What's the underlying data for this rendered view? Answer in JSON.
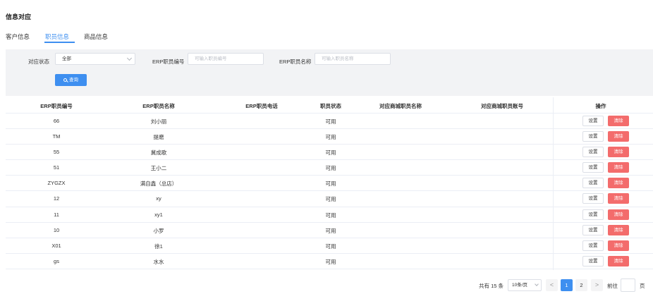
{
  "page": {
    "title": "信息对应"
  },
  "tabs": [
    {
      "label": "客户信息",
      "active": false
    },
    {
      "label": "职员信息",
      "active": true
    },
    {
      "label": "商品信息",
      "active": false
    }
  ],
  "filters": {
    "status_label": "对应状态",
    "status_value": "全部",
    "code_label": "ERP职员编号",
    "code_placeholder": "可输入职员编号",
    "name_label": "ERP职员名称",
    "name_placeholder": "可输入职员名称",
    "query_label": "查询"
  },
  "table": {
    "headers": [
      "ERP职员编号",
      "ERP职员名称",
      "ERP职员电话",
      "职员状态",
      "对应商城职员名称",
      "对应商城职员账号",
      "操作"
    ],
    "rows": [
      {
        "code": "66",
        "name": "刘小丽",
        "phone": "",
        "status": "可用",
        "mall_name": "",
        "mall_account": ""
      },
      {
        "code": "TM",
        "name": "提磨",
        "phone": "",
        "status": "可用",
        "mall_name": "",
        "mall_account": ""
      },
      {
        "code": "55",
        "name": "冀成歌",
        "phone": "",
        "status": "可用",
        "mall_name": "",
        "mall_account": ""
      },
      {
        "code": "51",
        "name": "王小二",
        "phone": "",
        "status": "可用",
        "mall_name": "",
        "mall_account": ""
      },
      {
        "code": "ZYGZX",
        "name": "满自鑫（总店）",
        "phone": "",
        "status": "可用",
        "mall_name": "",
        "mall_account": ""
      },
      {
        "code": "12",
        "name": "xy",
        "phone": "",
        "status": "可用",
        "mall_name": "",
        "mall_account": ""
      },
      {
        "code": "11",
        "name": "xy1",
        "phone": "",
        "status": "可用",
        "mall_name": "",
        "mall_account": ""
      },
      {
        "code": "10",
        "name": "小罗",
        "phone": "",
        "status": "可用",
        "mall_name": "",
        "mall_account": ""
      },
      {
        "code": "X01",
        "name": "徐1",
        "phone": "",
        "status": "可用",
        "mall_name": "",
        "mall_account": ""
      },
      {
        "code": "gs",
        "name": "水水",
        "phone": "",
        "status": "可用",
        "mall_name": "",
        "mall_account": ""
      }
    ],
    "set_label": "设置",
    "clear_label": "清除"
  },
  "pagination": {
    "total_text": "共有 15 条",
    "page_size": "10条/页",
    "prev": "<",
    "next": ">",
    "pages": [
      "1",
      "2"
    ],
    "current_page": "1",
    "goto_label": "前往",
    "page_suffix": "页"
  },
  "colors": {
    "accent": "#3e8ff0",
    "danger": "#f36c6c",
    "panel_bg": "#f2f3f5"
  }
}
